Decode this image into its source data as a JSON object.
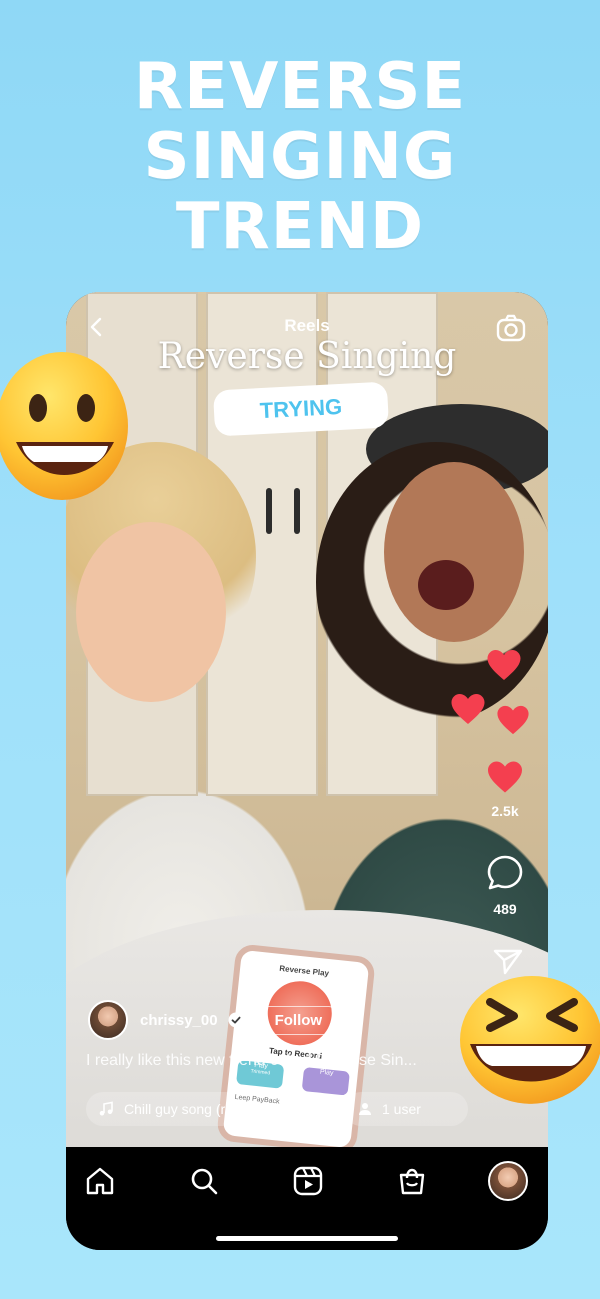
{
  "headline": {
    "line1": "REVERSE",
    "line2": "SINGING",
    "line3": "TREND"
  },
  "reels": {
    "header_title": "Reels",
    "overlay_title": "Reverse Singing",
    "badge_text": "TRYING"
  },
  "actions": {
    "like_count": "2.5k",
    "comment_count": "489"
  },
  "post": {
    "username": "chrissy_00",
    "follow_label": "Follow",
    "caption": "I really like this new trend called Reverse Sin...",
    "music_label": "Chill guy song (remix by s...",
    "users_label": "1 user"
  },
  "app_screen": {
    "title": "Reverse Play",
    "record_label": "Tap to Record",
    "play_label": "Play",
    "play_sub": "Trimmed",
    "loop_label": "Leep PayBack"
  },
  "nav": {
    "items": [
      "home-icon",
      "search-icon",
      "reels-icon",
      "shop-icon",
      "profile-avatar"
    ]
  },
  "colors": {
    "accent": "#4ec3ee",
    "heart": "#f43f4f",
    "background": "#9fe0fa"
  }
}
